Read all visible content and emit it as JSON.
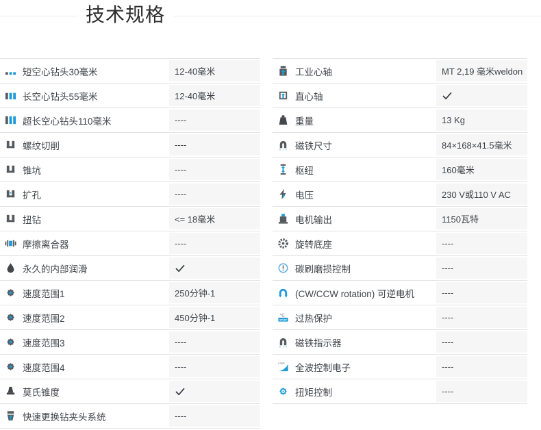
{
  "title": "技术规格",
  "colors": {
    "accent_blue": "#1e9bd7",
    "icon_gray": "#565b60",
    "icon_dark": "#43484d",
    "value_cell_bg": "#f6f6f6",
    "row_border": "#e2e2e2",
    "header_rule": "#ececec",
    "label_text": "#40454b",
    "value_text": "#3f4449",
    "title_text": "#2e2e2e",
    "check_color": "#3c4146"
  },
  "columns": [
    {
      "name": "left",
      "rows": [
        {
          "icon": "core-drill-short-icon",
          "label": "短空心钻头30毫米",
          "value": "12-40毫米"
        },
        {
          "icon": "core-drill-long-icon",
          "label": "长空心钻头55毫米",
          "value": "12-40毫米"
        },
        {
          "icon": "core-drill-extra-long-icon",
          "label": "超长空心钻头110毫米",
          "value": "----"
        },
        {
          "icon": "thread-cutting-icon",
          "label": "螺纹切削",
          "value": "----"
        },
        {
          "icon": "countersink-icon",
          "label": "锥坑",
          "value": "----"
        },
        {
          "icon": "reaming-icon",
          "label": "扩孔",
          "value": "----"
        },
        {
          "icon": "twist-drill-icon",
          "label": "扭钻",
          "value": "<= 18毫米"
        },
        {
          "icon": "friction-clutch-icon",
          "label": "摩擦离合器",
          "value": "----"
        },
        {
          "icon": "lubrication-drop-icon",
          "label": "永久的内部润滑",
          "value": "",
          "value_icon": "check-icon"
        },
        {
          "icon": "speed-gear-icon",
          "label": "速度范围1",
          "value": "250分钟-1"
        },
        {
          "icon": "speed-gear-icon",
          "label": "速度范围2",
          "value": "450分钟-1"
        },
        {
          "icon": "speed-gear-icon",
          "label": "速度范围3",
          "value": "----"
        },
        {
          "icon": "speed-gear-icon",
          "label": "速度范围4",
          "value": "----"
        },
        {
          "icon": "morse-taper-icon",
          "label": "莫氏锥度",
          "value": "",
          "value_icon": "check-icon"
        },
        {
          "icon": "quick-chuck-icon",
          "label": "快速更换钻夹头系统",
          "value": "----"
        }
      ]
    },
    {
      "name": "right",
      "rows": [
        {
          "icon": "industrial-arbor-icon",
          "label": "工业心轴",
          "value": "MT 2,19 毫米weldon"
        },
        {
          "icon": "straight-arbor-icon",
          "label": "直心轴",
          "value": "",
          "value_icon": "check-icon"
        },
        {
          "icon": "weight-icon",
          "label": "重量",
          "value": "13 Kg"
        },
        {
          "icon": "magnet-size-icon",
          "label": "磁铁尺寸",
          "value": "84×168×41.5毫米"
        },
        {
          "icon": "hub-stroke-icon",
          "label": "枢纽",
          "value": "160毫米"
        },
        {
          "icon": "voltage-icon",
          "label": "电压",
          "value": "230 V或110 V AC"
        },
        {
          "icon": "motor-output-icon",
          "label": "电机输出",
          "value": "1150瓦特"
        },
        {
          "icon": "rotating-base-icon",
          "label": "旋转底座",
          "value": "----"
        },
        {
          "icon": "brush-wear-icon",
          "label": "碳刷磨损控制",
          "value": "----"
        },
        {
          "icon": "reversible-motor-icon",
          "label": "(CW/CCW rotation) 可逆电机",
          "value": "----"
        },
        {
          "icon": "overheat-protection-icon",
          "label": "过热保护",
          "value": "----"
        },
        {
          "icon": "magnet-indicator-icon",
          "label": "磁铁指示器",
          "value": "----"
        },
        {
          "icon": "full-wave-electronics-icon",
          "label": "全波控制电子",
          "value": "----"
        },
        {
          "icon": "torque-control-icon",
          "label": "扭矩控制",
          "value": "----"
        }
      ]
    }
  ]
}
